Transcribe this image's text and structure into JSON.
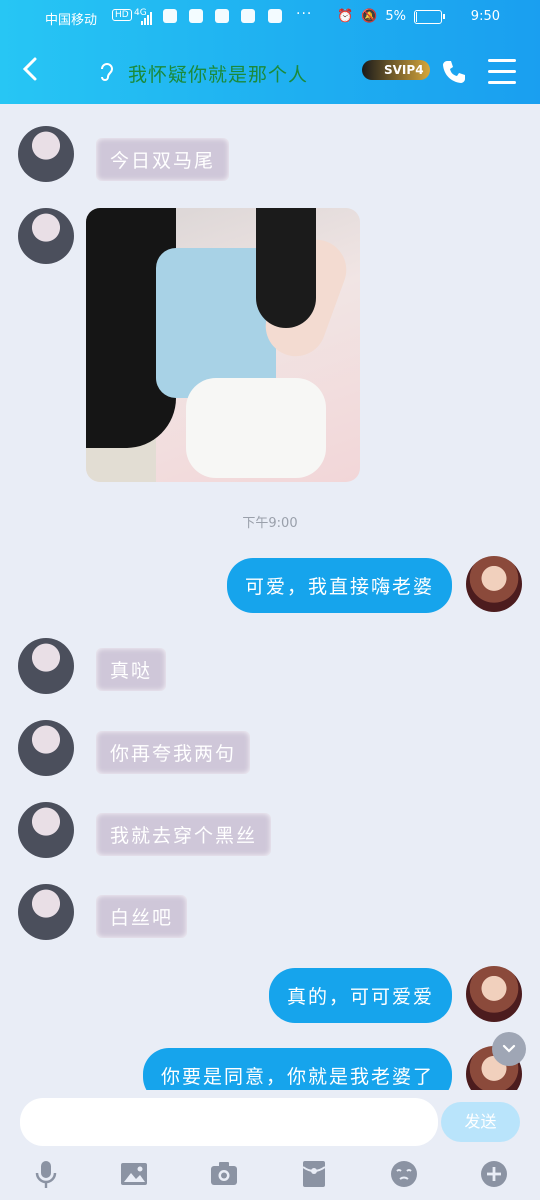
{
  "status_bar": {
    "carrier": "中国移动",
    "network": "HD",
    "signal_gen": "4G",
    "battery": "5%",
    "battery_level": 0.05,
    "time": "9:50",
    "icons": [
      "alarm-icon",
      "mute-icon"
    ]
  },
  "header": {
    "back_icon": "chevron-left-icon",
    "title": "我怀疑你就是那个人",
    "badge": "SVIP4",
    "call_icon": "phone-icon",
    "menu_icon": "menu-icon"
  },
  "chat": {
    "messages": [
      {
        "side": "in",
        "type": "text",
        "text": "今日双马尾"
      },
      {
        "side": "in",
        "type": "image",
        "text": ""
      },
      {
        "side": "time",
        "text": "下午9:00"
      },
      {
        "side": "out",
        "type": "text",
        "text": "可爱，我直接嗨老婆"
      },
      {
        "side": "in",
        "type": "text",
        "text": "真哒"
      },
      {
        "side": "in",
        "type": "text",
        "text": "你再夸我两句"
      },
      {
        "side": "in",
        "type": "text",
        "text": "我就去穿个黑丝"
      },
      {
        "side": "in",
        "type": "text",
        "text": "白丝吧"
      },
      {
        "side": "out",
        "type": "text",
        "text": "真的，可可爱爱"
      },
      {
        "side": "out",
        "type": "text",
        "text": "你要是同意，你就是我老婆了"
      }
    ]
  },
  "input_bar": {
    "placeholder": "",
    "send_label": "发送",
    "tools": [
      "microphone-icon",
      "image-icon",
      "camera-icon",
      "red-packet-icon",
      "emoji-icon",
      "plus-icon"
    ]
  },
  "colors": {
    "header_start": "#27c6f4",
    "header_end": "#1a9ff0",
    "out_bubble": "#16a4ec",
    "in_bubble": "#cfc7d9",
    "background": "#e9edf6"
  }
}
